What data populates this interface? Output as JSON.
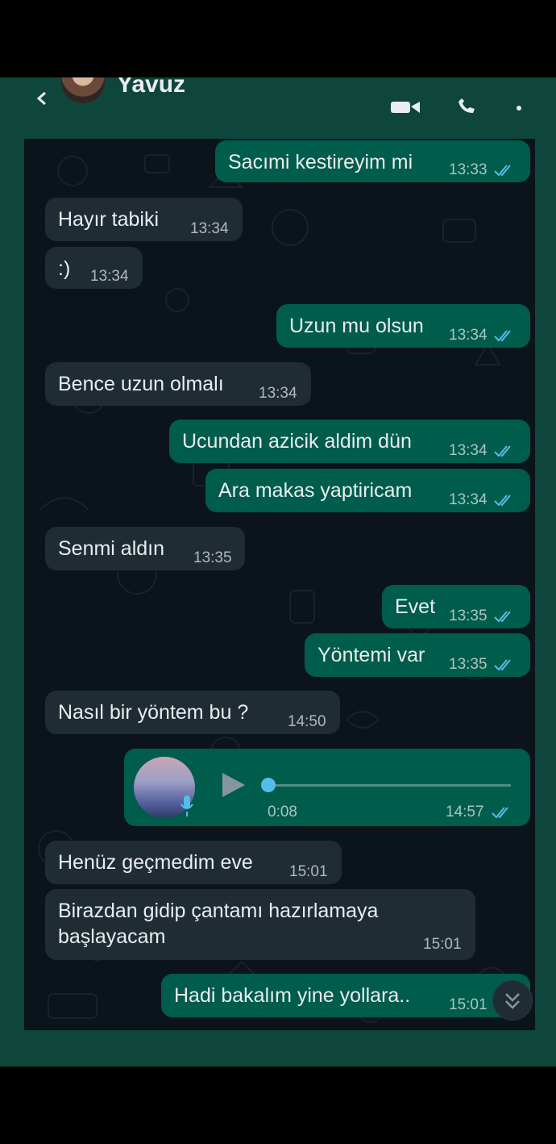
{
  "header": {
    "contact_name": "Yavuz"
  },
  "messages": [
    {
      "direction": "out",
      "text": "Sacımi kestireyim mi",
      "time": "13:33",
      "status": "read"
    },
    {
      "direction": "in",
      "text": "Hayır tabiki",
      "time": "13:34"
    },
    {
      "direction": "in",
      "text": ":)",
      "time": "13:34"
    },
    {
      "direction": "out",
      "text": "Uzun mu olsun",
      "time": "13:34",
      "status": "read"
    },
    {
      "direction": "in",
      "text": "Bence uzun olmalı",
      "time": "13:34"
    },
    {
      "direction": "out",
      "text": "Ucundan azicik aldim dün",
      "time": "13:34",
      "status": "read"
    },
    {
      "direction": "out",
      "text": "Ara makas yaptiricam",
      "time": "13:34",
      "status": "read"
    },
    {
      "direction": "in",
      "text": "Senmi aldın",
      "time": "13:35"
    },
    {
      "direction": "out",
      "text": "Evet",
      "time": "13:35",
      "status": "read"
    },
    {
      "direction": "out",
      "text": "Yöntemi var",
      "time": "13:35",
      "status": "read"
    },
    {
      "direction": "in",
      "text": "Nasıl bir yöntem bu ?",
      "time": "14:50"
    },
    {
      "direction": "out",
      "type": "voice",
      "duration": "0:08",
      "time": "14:57",
      "status": "read",
      "progress": 0.0
    },
    {
      "direction": "in",
      "text": "Henüz geçmedim eve",
      "time": "15:01"
    },
    {
      "direction": "in",
      "text_line1": "Birazdan gidip çantamı hazırlamaya",
      "text_line2": "başlayacam",
      "time": "15:01"
    },
    {
      "direction": "out",
      "text": "Hadi bakalım yine yollara..",
      "time": "15:01"
    }
  ],
  "colors": {
    "chat_bg": "#0b141a",
    "bubble_in": "#1f2c33",
    "bubble_out": "#005c4b",
    "read_tick": "#53bdeb",
    "frame": "#0e463b"
  },
  "icons": [
    "back-arrow-icon",
    "video-call-icon",
    "phone-call-icon",
    "more-options-icon",
    "play-icon",
    "microphone-icon",
    "double-check-icon",
    "chevron-double-down-icon"
  ]
}
